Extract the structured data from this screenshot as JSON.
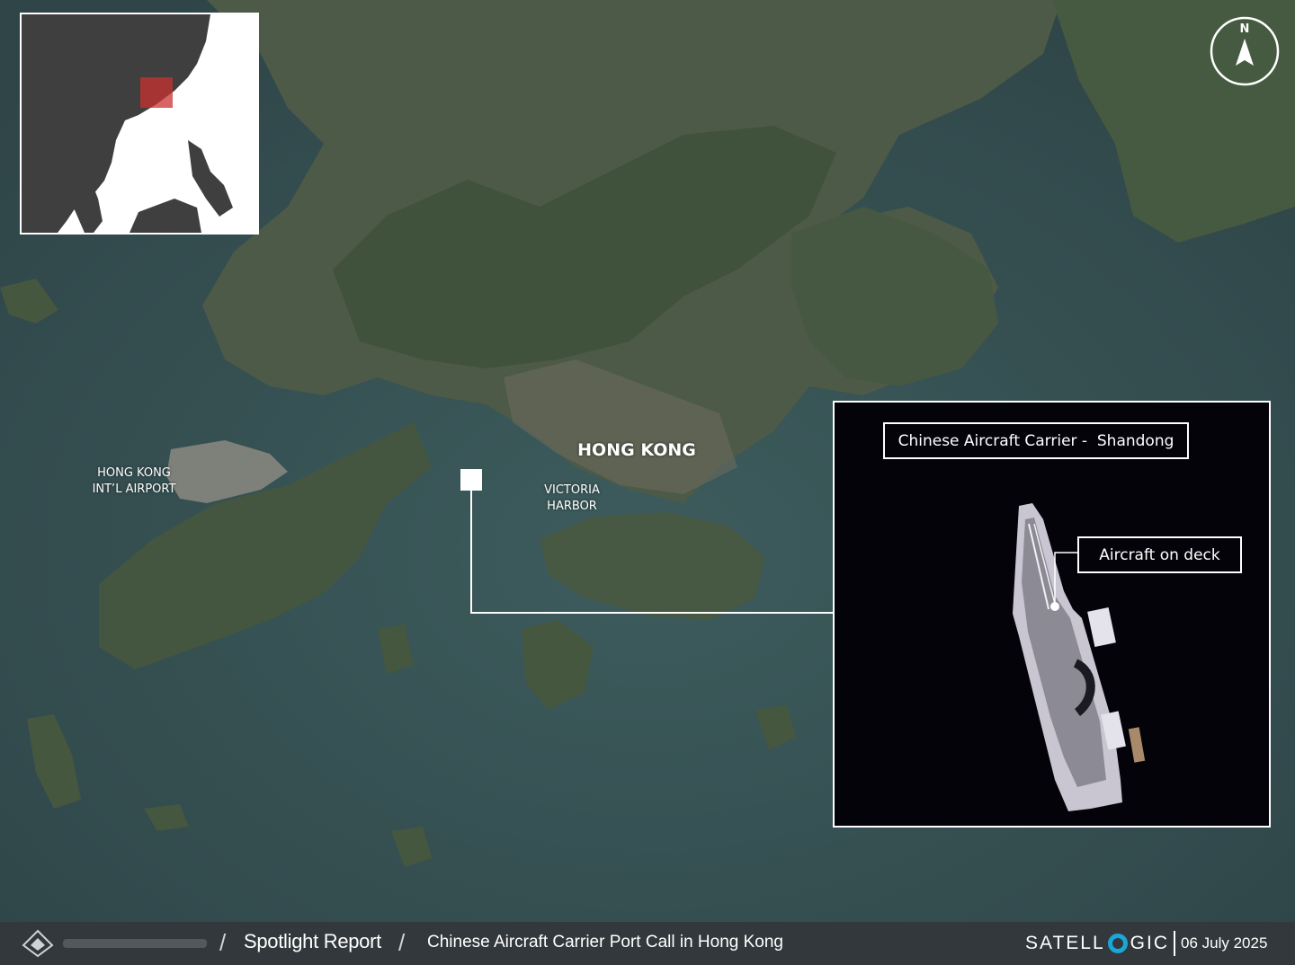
{
  "map": {
    "places": {
      "airport": "HONG KONG\nINT’L AIRPORT",
      "city": "HONG KONG",
      "harbor": "VICTORIA\nHARBOR"
    },
    "north_label": "N"
  },
  "detail": {
    "title": "Chinese Aircraft Carrier -  Shandong",
    "callout": "Aircraft on deck"
  },
  "footer": {
    "report": "Spotlight Report",
    "subject": "Chinese Aircraft Carrier Port Call in Hong Kong",
    "brand_part1": "SATELL",
    "brand_part2": "GIC",
    "date": "06 July 2025"
  },
  "colors": {
    "sea": "#3e5a5c",
    "land": "#4a5a44",
    "inset_highlight": "#c8322f",
    "brand_accent": "#1aa7d8"
  }
}
